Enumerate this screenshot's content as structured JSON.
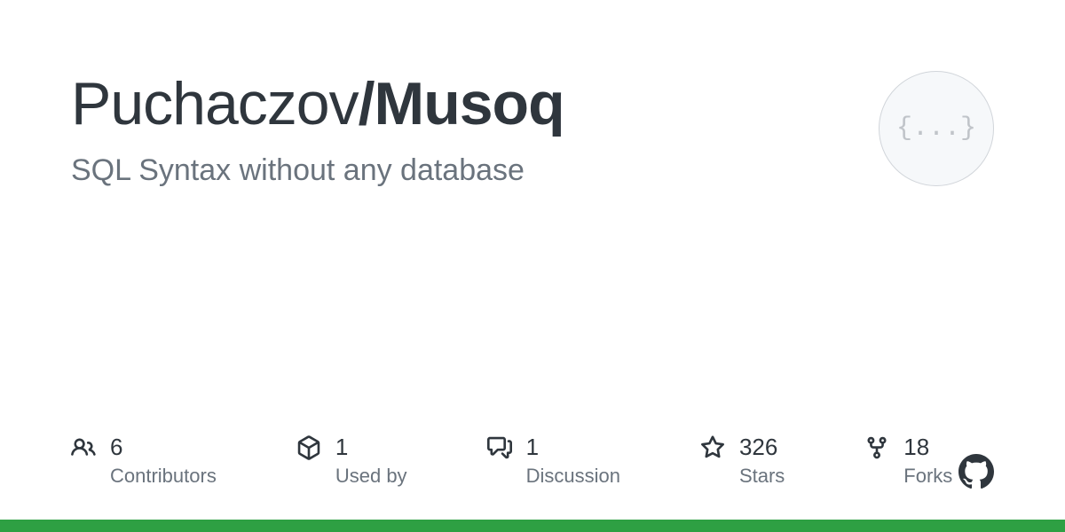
{
  "repo": {
    "owner": "Puchaczov",
    "separator": "/",
    "name": "Musoq",
    "description": "SQL Syntax without any database",
    "avatar_text": "{...}"
  },
  "stats": {
    "contributors": {
      "count": "6",
      "label": "Contributors"
    },
    "used_by": {
      "count": "1",
      "label": "Used by"
    },
    "discussions": {
      "count": "1",
      "label": "Discussion"
    },
    "stars": {
      "count": "326",
      "label": "Stars"
    },
    "forks": {
      "count": "18",
      "label": "Forks"
    }
  },
  "colors": {
    "accent": "#2ea043"
  }
}
